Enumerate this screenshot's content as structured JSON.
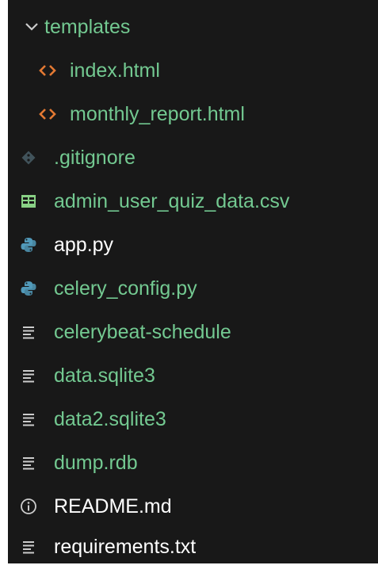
{
  "explorer": {
    "items": [
      {
        "label": "templates",
        "icon": "chevron-down-icon",
        "color": "#73c991",
        "kind": "folder"
      },
      {
        "label": "index.html",
        "icon": "html-icon",
        "color": "#73c991",
        "kind": "file"
      },
      {
        "label": "monthly_report.html",
        "icon": "html-icon",
        "color": "#73c991",
        "kind": "file"
      },
      {
        "label": ".gitignore",
        "icon": "git-icon",
        "color": "#73c991",
        "kind": "file"
      },
      {
        "label": "admin_user_quiz_data.csv",
        "icon": "table-icon",
        "color": "#73c991",
        "kind": "file"
      },
      {
        "label": "app.py",
        "icon": "python-icon",
        "color": "#ffffff",
        "kind": "file"
      },
      {
        "label": "celery_config.py",
        "icon": "python-icon",
        "color": "#73c991",
        "kind": "file"
      },
      {
        "label": "celerybeat-schedule",
        "icon": "text-lines-icon",
        "color": "#73c991",
        "kind": "file"
      },
      {
        "label": "data.sqlite3",
        "icon": "text-lines-icon",
        "color": "#73c991",
        "kind": "file"
      },
      {
        "label": "data2.sqlite3",
        "icon": "text-lines-icon",
        "color": "#73c991",
        "kind": "file"
      },
      {
        "label": "dump.rdb",
        "icon": "text-lines-icon",
        "color": "#73c991",
        "kind": "file"
      },
      {
        "label": "README.md",
        "icon": "info-icon",
        "color": "#ffffff",
        "kind": "file"
      },
      {
        "label": "requirements.txt",
        "icon": "text-lines-icon",
        "color": "#ffffff",
        "kind": "file"
      }
    ]
  },
  "colors": {
    "background": "#181818",
    "modified": "#73c991",
    "html_icon": "#e37933",
    "git_icon": "#41535b",
    "csv_icon": "#89d185",
    "python_icon": "#519aba",
    "lines_icon": "#cccccc",
    "info_icon": "#cccccc"
  }
}
